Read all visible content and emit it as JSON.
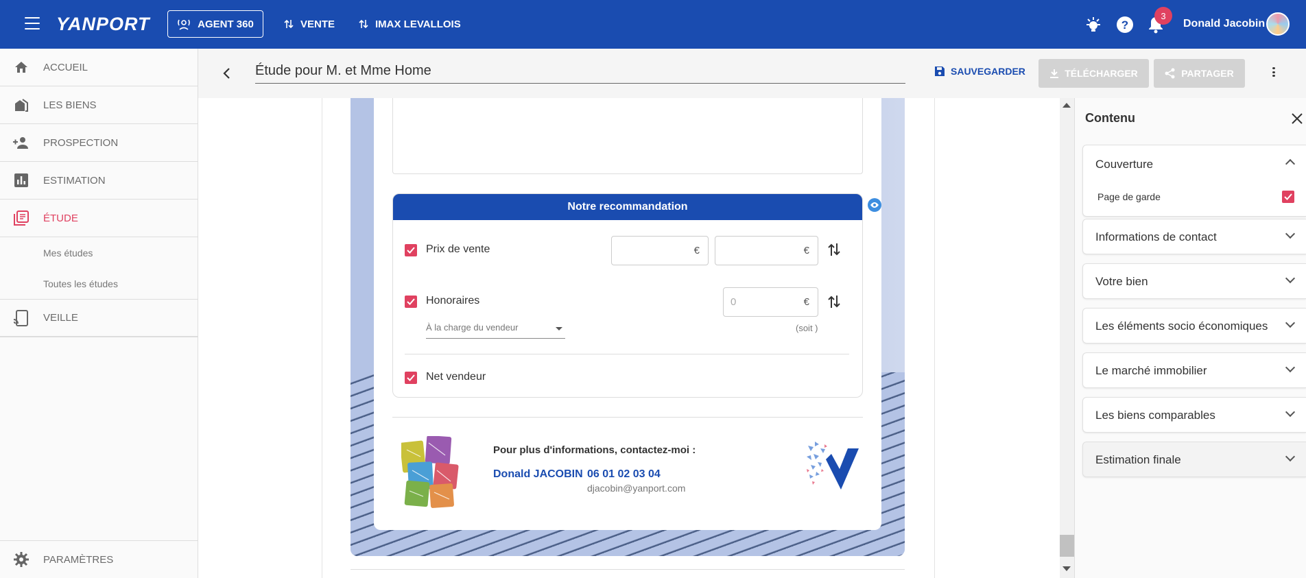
{
  "topbar": {
    "brand": "YANPORT",
    "agent_label": "AGENT 360",
    "vente_label": "VENTE",
    "imax_label": "IMAX LEVALLOIS",
    "notifications_count": "3",
    "user_name": "Donald Jacobin",
    "bg_color": "#1a4cb0"
  },
  "sidebar": {
    "items": [
      {
        "label": "ACCUEIL",
        "icon": "home-icon"
      },
      {
        "label": "LES BIENS",
        "icon": "buildings-icon"
      },
      {
        "label": "PROSPECTION",
        "icon": "person-add-icon"
      },
      {
        "label": "ESTIMATION",
        "icon": "bar-chart-icon"
      },
      {
        "label": "ÉTUDE",
        "icon": "book-icon"
      },
      {
        "label": "VEILLE",
        "icon": "tablet-icon"
      }
    ],
    "sub_items": [
      "Mes études",
      "Toutes les études"
    ],
    "settings_label": "PARAMÈTRES",
    "active_color": "#e04160"
  },
  "header": {
    "title": "Étude pour M. et Mme Home",
    "save_label": "SAUVEGARDER",
    "download_label": "TÉLÉCHARGER",
    "share_label": "PARTAGER"
  },
  "recommendation": {
    "title": "Notre recommandation",
    "prix_label": "Prix de vente",
    "prix_min": "€",
    "prix_max": "€",
    "honoraires_label": "Honoraires",
    "honoraires_placeholder": "0",
    "honoraires_unit": "€",
    "charge_select": "À la charge du vendeur",
    "soit_label": "(soit )",
    "net_label": "Net vendeur"
  },
  "contact": {
    "heading": "Pour plus d'informations, contactez-moi :",
    "name": "Donald JACOBIN",
    "phone": "06 01 02 03 04",
    "email": "djacobin@yanport.com"
  },
  "panel": {
    "title": "Contenu",
    "sections": [
      "Couverture",
      "Informations de contact",
      "Votre bien",
      "Les éléments socio économiques",
      "Le marché immobilier",
      "Les biens comparables",
      "Estimation finale"
    ],
    "couverture_sub": "Page de garde"
  }
}
